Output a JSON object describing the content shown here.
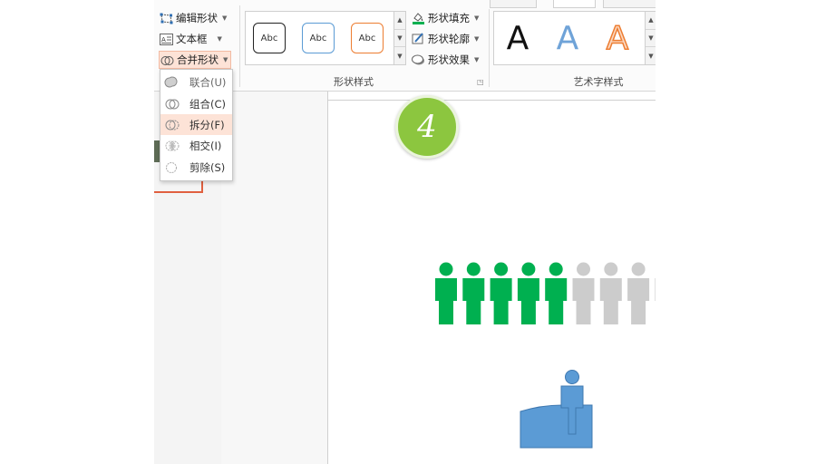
{
  "ribbon": {
    "insert_shape_group": {
      "edit_shape": "编辑形状",
      "text_box": "文本框",
      "merge_shapes": "合并形状"
    },
    "shape_styles": {
      "label": "形状样式",
      "samples": [
        "Abc",
        "Abc",
        "Abc"
      ],
      "fill": "形状填充",
      "outline": "形状轮廓",
      "effects": "形状效果"
    },
    "wordart_styles": {
      "label": "艺术字样式",
      "samples": [
        "A",
        "A",
        "A"
      ]
    }
  },
  "merge_menu": {
    "items": [
      {
        "label": "联合(U)"
      },
      {
        "label": "组合(C)"
      },
      {
        "label": "拆分(F)"
      },
      {
        "label": "相交(I)"
      },
      {
        "label": "剪除(S)"
      }
    ]
  },
  "step_badge": "4",
  "colors": {
    "accent_highlight": "#fde3d7",
    "badge_green": "#8cc63f",
    "person_green": "#00b050",
    "person_gray": "#cccccc",
    "shape_blue": "#5b9bd5",
    "thumbnail_border": "#e06040",
    "outline_blue": "#5b9bd5",
    "outline_orange": "#ed7d31"
  },
  "icons": [
    "edit-shape-icon",
    "text-box-icon",
    "merge-shapes-icon",
    "shape-fill-icon",
    "shape-outline-icon",
    "shape-effects-icon",
    "union-icon",
    "combine-icon",
    "fragment-icon",
    "intersect-icon",
    "subtract-icon",
    "dialog-launcher-icon"
  ]
}
